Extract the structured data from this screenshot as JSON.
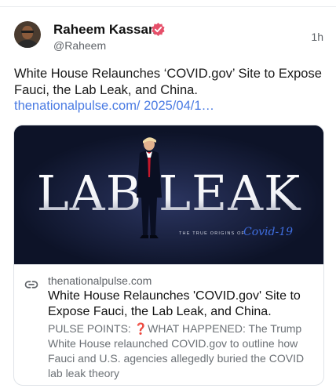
{
  "author": {
    "display_name": "Raheem Kassam",
    "handle": "@Raheem",
    "verified": true
  },
  "post": {
    "time": "1h",
    "text": "White House Relaunches ‘COVID.gov’ Site to Expose Fauci, the Lab Leak, and China.",
    "link_text": "thenationalpulse.com/ 2025/04/1…"
  },
  "link_card": {
    "image": {
      "headline": "LAB LEAK",
      "tagline": "THE TRUE ORIGINS OF",
      "script_text": "Covid-19"
    },
    "domain": "thenationalpulse.com",
    "title": "White House Relaunches 'COVID.gov' Site to Expose Fauci, the Lab Leak, and China.",
    "description_prefix": "PULSE POINTS:",
    "description_mark": "❓",
    "description_rest": "WHAT HAPPENED: The Trump White House relaunched COVID.gov to outline how Fauci and U.S. agencies allegedly buried the COVID lab leak theory"
  },
  "colors": {
    "link": "#4a7be3",
    "verified": "#e6506a",
    "card_bg": "#0d1328"
  },
  "icons": [
    "avatar",
    "verified-badge-icon",
    "link-icon"
  ]
}
